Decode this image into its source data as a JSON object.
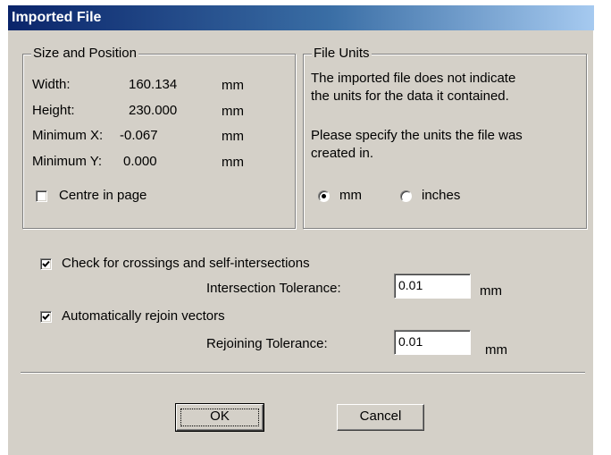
{
  "title": "Imported File",
  "size_position": {
    "legend": "Size and Position",
    "rows": [
      {
        "label": "Width:",
        "value": "160.134",
        "unit": "mm"
      },
      {
        "label": "Height:",
        "value": "230.000",
        "unit": "mm"
      },
      {
        "label": "Minimum X:",
        "value": "-0.067",
        "unit": "mm"
      },
      {
        "label": "Minimum Y:",
        "value": "0.000",
        "unit": "mm"
      }
    ],
    "centre_label": "Centre in page",
    "centre_checked": false
  },
  "file_units": {
    "legend": "File Units",
    "message_line1": "The imported file does not indicate",
    "message_line2": "the units for the data it contained.",
    "instruction_line1": "Please specify the units the file was",
    "instruction_line2": "created in.",
    "options": [
      {
        "label": "mm",
        "selected": true
      },
      {
        "label": "inches",
        "selected": false
      }
    ]
  },
  "crossings": {
    "label": "Check for crossings and self-intersections",
    "checked": true,
    "tolerance_label": "Intersection Tolerance:",
    "tolerance_value": "0.01",
    "unit": "mm"
  },
  "rejoin": {
    "label": "Automatically rejoin vectors",
    "checked": true,
    "tolerance_label": "Rejoining Tolerance:",
    "tolerance_value": "0.01",
    "unit": "mm"
  },
  "buttons": {
    "ok": "OK",
    "cancel": "Cancel"
  },
  "colors": {
    "dialog_face": "#d4d0c8",
    "title_start": "#0a246a",
    "title_end": "#a6caf0"
  }
}
